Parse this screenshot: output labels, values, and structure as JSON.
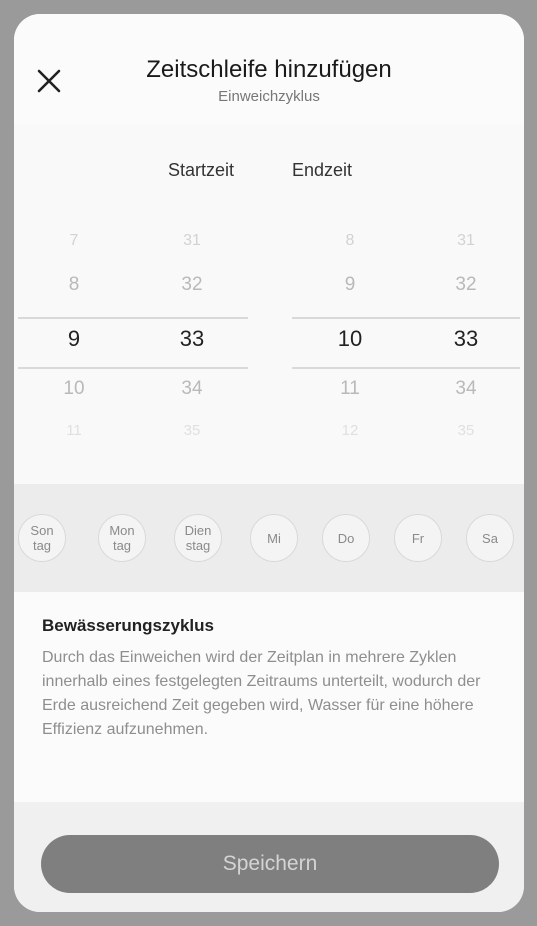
{
  "header": {
    "title": "Zeitschleife hinzufügen",
    "subtitle": "Einweichzyklus",
    "close_icon": "close-icon"
  },
  "picker": {
    "start_label": "Startzeit",
    "end_label": "Endzeit",
    "start_hours": [
      "7",
      "8",
      "9",
      "10",
      "11"
    ],
    "start_minutes": [
      "31",
      "32",
      "33",
      "34",
      "35"
    ],
    "end_hours": [
      "8",
      "9",
      "10",
      "11",
      "12"
    ],
    "end_minutes": [
      "31",
      "32",
      "33",
      "34",
      "35"
    ],
    "selected_start": "9:33",
    "selected_end": "10:33"
  },
  "days": [
    {
      "label": "Son\ntag"
    },
    {
      "label": "Mon\ntag"
    },
    {
      "label": "Dien\nstag"
    },
    {
      "label": "Mi"
    },
    {
      "label": "Do"
    },
    {
      "label": "Fr"
    },
    {
      "label": "Sa"
    }
  ],
  "info": {
    "title": "Bewässerungszyklus",
    "text": "Durch das Einweichen wird der Zeitplan in mehrere Zyklen innerhalb eines festgelegten Zeitraums unterteilt, wodurch der Erde ausreichend Zeit gegeben wird, Wasser für eine höhere Effizienz aufzunehmen."
  },
  "footer": {
    "save_label": "Speichern"
  }
}
